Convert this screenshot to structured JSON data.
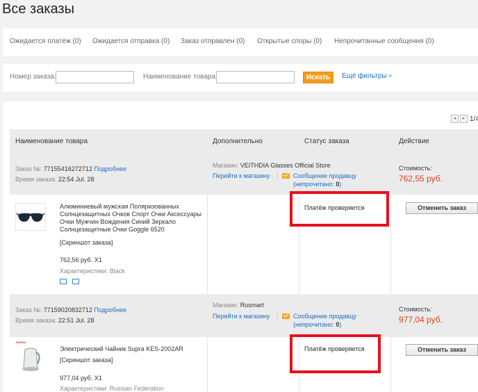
{
  "page": {
    "title": "Все заказы"
  },
  "tabs": [
    {
      "label": "Ожидается платёж (0)"
    },
    {
      "label": "Ожидается отправка (0)"
    },
    {
      "label": "Заказ отправлен (0)"
    },
    {
      "label": "Открытые споры (0)"
    },
    {
      "label": "Непрочитанные сообщения (0)"
    }
  ],
  "filters": {
    "order_number_label": "Номер заказа:",
    "order_number_value": "",
    "product_name_label": "Наименование товара:",
    "product_name_value": "",
    "search_label": "Искать",
    "more_filters_label": "Ещё фильтры"
  },
  "pager": {
    "prev": "◂",
    "next": "▸",
    "count": "1/4"
  },
  "table": {
    "headers": [
      "Наименование товара",
      "Дополнительно",
      "Статус заказа",
      "Действие"
    ]
  },
  "orders": [
    {
      "order_label": "Заказ №:",
      "order_no": "77155416272712",
      "details_link": "Подробнее",
      "time_label": "Время заказа:",
      "time": "22:54 Jul. 28",
      "store_label": "Магазин:",
      "store": "VEITHDIA Glasses Official Store",
      "go_to_store": "Перейти к магазину",
      "message_seller": "Сообщение продавцу",
      "unread_prefix": "(непрочитано:",
      "unread_count": "0",
      "unread_suffix": ")",
      "cost_label": "Стоимость:",
      "cost": "762,55 руб.",
      "product_name": "Алюминиевый мужская Поляризованных Солнцезащитных Очков Спорт Очки Аксессуары Очки Мужчин Вождения Синий Зеркало Солнцезащитные Очки Goggle 6520",
      "screenshot": "[Скриншот заказа]",
      "item_price": "762,56 руб. X1",
      "characteristics_label": "Характеристики:",
      "characteristics": "Black",
      "status": "Платёж проверяется",
      "cancel_label": "Отменить заказ"
    },
    {
      "order_label": "Заказ №:",
      "order_no": "77159020832712",
      "details_link": "Подробнее",
      "time_label": "Время заказа:",
      "time": "22:51 Jul. 28",
      "store_label": "Магазин:",
      "store": "Rusmart",
      "go_to_store": "Перейти к магазину",
      "message_seller": "Сообщение продавцу",
      "unread_prefix": "(непрочитано:",
      "unread_count": "0",
      "unread_suffix": ")",
      "cost_label": "Стоимость:",
      "cost": "977,04 руб.",
      "product_name": "Электрический Чайник Supra KES-2002AR",
      "screenshot": "[Скриншот заказа]",
      "item_price": "977,04 руб. X1",
      "characteristics_label": "Характеристики:",
      "characteristics": "Russian Federation",
      "status": "Платёж проверяется",
      "cancel_label": "Отменить заказ",
      "thumb_brand": "SUPRA"
    }
  ],
  "colors": {
    "accent": "#f29c1f",
    "link": "#1a6dc4",
    "price": "#e0401c",
    "highlight": "#e8101e"
  }
}
